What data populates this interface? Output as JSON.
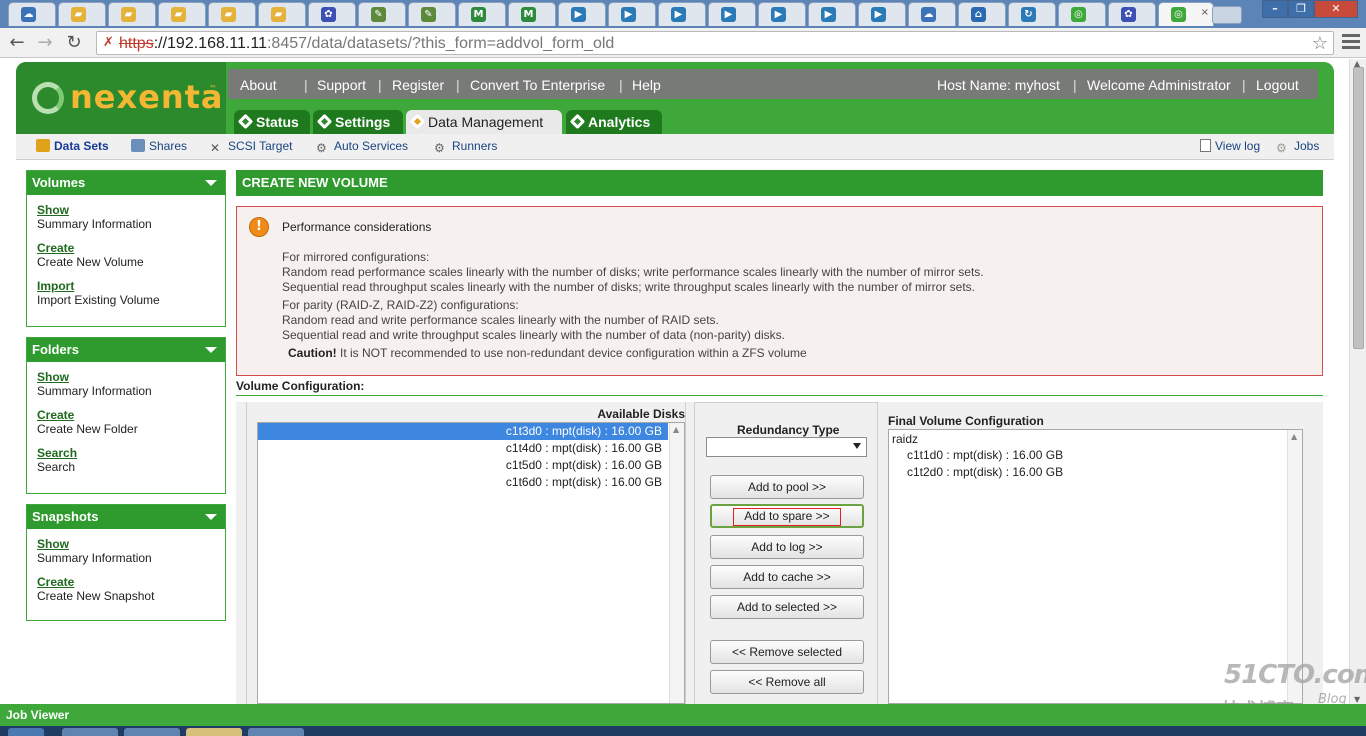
{
  "browser": {
    "tabs": [
      {
        "icon": "cloud-lock-icon",
        "color": "#3b73b9"
      },
      {
        "icon": "folder-icon",
        "color": "#e6b33a"
      },
      {
        "icon": "folder-icon",
        "color": "#e6b33a"
      },
      {
        "icon": "folder-icon",
        "color": "#e6b33a"
      },
      {
        "icon": "folder-icon",
        "color": "#e6b33a"
      },
      {
        "icon": "folder-icon",
        "color": "#e6b33a"
      },
      {
        "icon": "paw-icon",
        "color": "#3b4fb5"
      },
      {
        "icon": "document-icon",
        "color": "#5c8a3a"
      },
      {
        "icon": "document-icon",
        "color": "#5c8a3a"
      },
      {
        "icon": "mx-icon",
        "color": "#2e8b3e"
      },
      {
        "icon": "mx-icon",
        "color": "#2e8b3e"
      },
      {
        "icon": "play-circle-icon",
        "color": "#2a7ab8"
      },
      {
        "icon": "play-circle-icon",
        "color": "#2a7ab8"
      },
      {
        "icon": "play-circle-icon",
        "color": "#2a7ab8"
      },
      {
        "icon": "play-circle-icon",
        "color": "#2a7ab8"
      },
      {
        "icon": "play-circle-icon",
        "color": "#2a7ab8"
      },
      {
        "icon": "play-circle-icon",
        "color": "#2a7ab8"
      },
      {
        "icon": "play-circle-icon",
        "color": "#2a7ab8"
      },
      {
        "icon": "cloud-lock-icon",
        "color": "#3b73b9"
      },
      {
        "icon": "home-icon",
        "color": "#2a6ab0"
      },
      {
        "icon": "refresh-icon",
        "color": "#2a7ab8"
      },
      {
        "icon": "nexenta-icon",
        "color": "#3ea83a"
      },
      {
        "icon": "paw-icon",
        "color": "#3b4fb5"
      }
    ],
    "active_tab": {
      "icon": "nexenta-icon",
      "color": "#3ea83a",
      "close": "×"
    },
    "url": {
      "scheme": "https",
      "host": "://192.168.11.11",
      "rest": ":8457/data/datasets/?this_form=addvol_form_old"
    }
  },
  "header": {
    "logo_text": "nexenta",
    "logo_tm": "™",
    "links": [
      "About",
      "Support",
      "Register",
      "Convert To Enterprise",
      "Help"
    ],
    "host_name": "Host Name: myhost",
    "welcome": "Welcome Administrator",
    "logout": "Logout",
    "tabs": [
      "Status",
      "Settings",
      "Data Management",
      "Analytics"
    ],
    "active_tab": "Data Management"
  },
  "subnav": {
    "items": [
      "Data Sets",
      "Shares",
      "SCSI Target",
      "Auto Services",
      "Runners"
    ],
    "right": [
      "View log",
      "Jobs"
    ]
  },
  "sidebar": [
    {
      "title": "Volumes",
      "items": [
        {
          "link": "Show",
          "desc": "Summary Information"
        },
        {
          "link": "Create",
          "desc": "Create New Volume"
        },
        {
          "link": "Import",
          "desc": "Import Existing Volume"
        }
      ]
    },
    {
      "title": "Folders",
      "items": [
        {
          "link": "Show",
          "desc": "Summary Information"
        },
        {
          "link": "Create",
          "desc": "Create New Folder"
        },
        {
          "link": "Search",
          "desc": "Search"
        }
      ]
    },
    {
      "title": "Snapshots",
      "items": [
        {
          "link": "Show",
          "desc": "Summary Information"
        },
        {
          "link": "Create",
          "desc": "Create New Snapshot"
        }
      ]
    }
  ],
  "main": {
    "title": "CREATE NEW VOLUME",
    "alert": {
      "title": "Performance considerations",
      "lines": [
        "For mirrored configurations:",
        "Random read performance scales linearly with the number of disks; write performance scales linearly with the number of mirror sets.",
        "Sequential read throughput scales linearly with the number of disks; write throughput scales linearly with the number of mirror sets.",
        "For parity (RAID-Z, RAID-Z2) configurations:",
        "Random read and write performance scales linearly with the number of RAID sets.",
        "Sequential read and write throughput scales linearly with the number of data (non-parity) disks."
      ],
      "caution_label": "Caution!",
      "caution_text": " It is NOT recommended to use non-redundant device configuration within a ZFS volume"
    },
    "volume_config_label": "Volume Configuration:",
    "available_disks_label": "Available Disks",
    "available_disks": [
      "c1t3d0 : mpt(disk) : 16.00 GB",
      "c1t4d0 : mpt(disk) : 16.00 GB",
      "c1t5d0 : mpt(disk) : 16.00 GB",
      "c1t6d0 : mpt(disk) : 16.00 GB"
    ],
    "selected_disk": "c1t3d0 : mpt(disk) : 16.00 GB",
    "redundancy_label": "Redundancy Type",
    "redundancy_value": "",
    "buttons": [
      "Add to pool >>",
      "Add to spare >>",
      "Add to log >>",
      "Add to cache >>",
      "Add to selected >>",
      "<< Remove selected",
      "<< Remove all"
    ],
    "highlighted_button": "Add to spare >>",
    "final_label": "Final Volume Configuration",
    "final_root": "raidz",
    "final_children": [
      "c1t1d0 : mpt(disk) : 16.00 GB",
      "c1t2d0 : mpt(disk) : 16.00 GB"
    ]
  },
  "watermark": {
    "line1": "51CTO.com",
    "line2": "技术博客",
    "line3": "Blog"
  },
  "job_viewer": "Job Viewer"
}
